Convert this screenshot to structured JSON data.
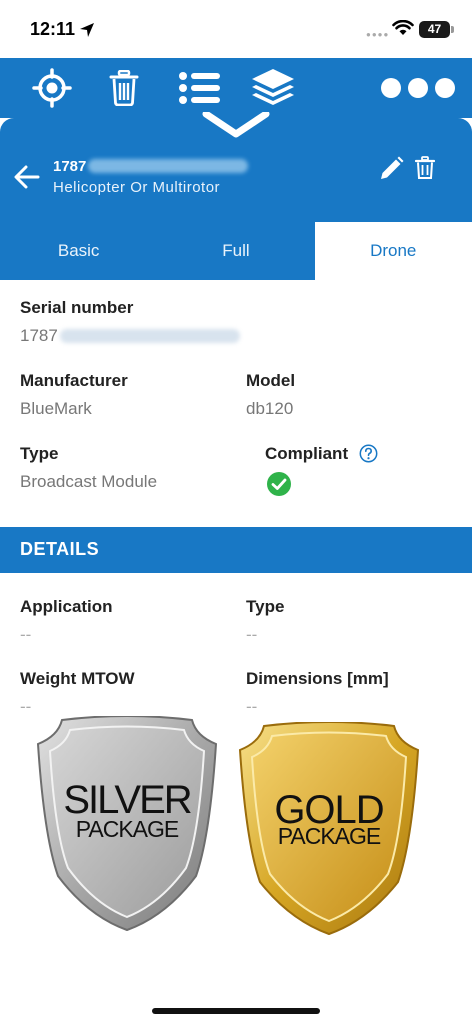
{
  "status_bar": {
    "time": "12:11",
    "battery": "47"
  },
  "header": {
    "serial_prefix": "1787",
    "subtitle": "Helicopter Or Multirotor"
  },
  "tabs": [
    {
      "label": "Basic"
    },
    {
      "label": "Full"
    },
    {
      "label": "Drone"
    }
  ],
  "fields": {
    "serial_number": {
      "label": "Serial number",
      "value_prefix": "1787"
    },
    "manufacturer": {
      "label": "Manufacturer",
      "value": "BlueMark"
    },
    "model": {
      "label": "Model",
      "value": "db120"
    },
    "type": {
      "label": "Type",
      "value": "Broadcast Module"
    },
    "compliant": {
      "label": "Compliant"
    }
  },
  "details": {
    "title": "DETAILS",
    "application": {
      "label": "Application",
      "value": "--"
    },
    "type": {
      "label": "Type",
      "value": "--"
    },
    "weight": {
      "label": "Weight MTOW",
      "value": "--"
    },
    "dimensions": {
      "label": "Dimensions [mm]",
      "value": "--"
    }
  },
  "packages": {
    "silver": {
      "line1": "SILVER",
      "line2": "PACKAGE"
    },
    "gold": {
      "line1": "GOLD",
      "line2": "PACKAGE"
    }
  },
  "colors": {
    "primary": "#1878c5",
    "check": "#2fb34a",
    "silver": "#b5b5b5",
    "gold": "#d8a92a"
  }
}
